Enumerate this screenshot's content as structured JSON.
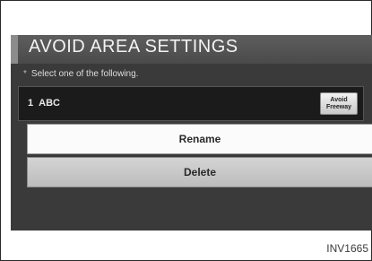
{
  "screen": {
    "title": "AVOID AREA SETTINGS",
    "instruction": "Select one of the following.",
    "instruction_bullet": "*",
    "list_item": {
      "number": "1",
      "name": "ABC",
      "freeway_button": {
        "line1": "Avoid",
        "line2": "Freeway"
      }
    },
    "rename_label": "Rename",
    "delete_label": "Delete"
  },
  "figure_code": "INV1665",
  "colors": {
    "screen_background": "#3a3a3a",
    "header_background": "#4a4a4a",
    "list_row_background": "#1b1b1b",
    "rename_button": "#fbfbfb",
    "delete_button": "#c8c8c8"
  }
}
